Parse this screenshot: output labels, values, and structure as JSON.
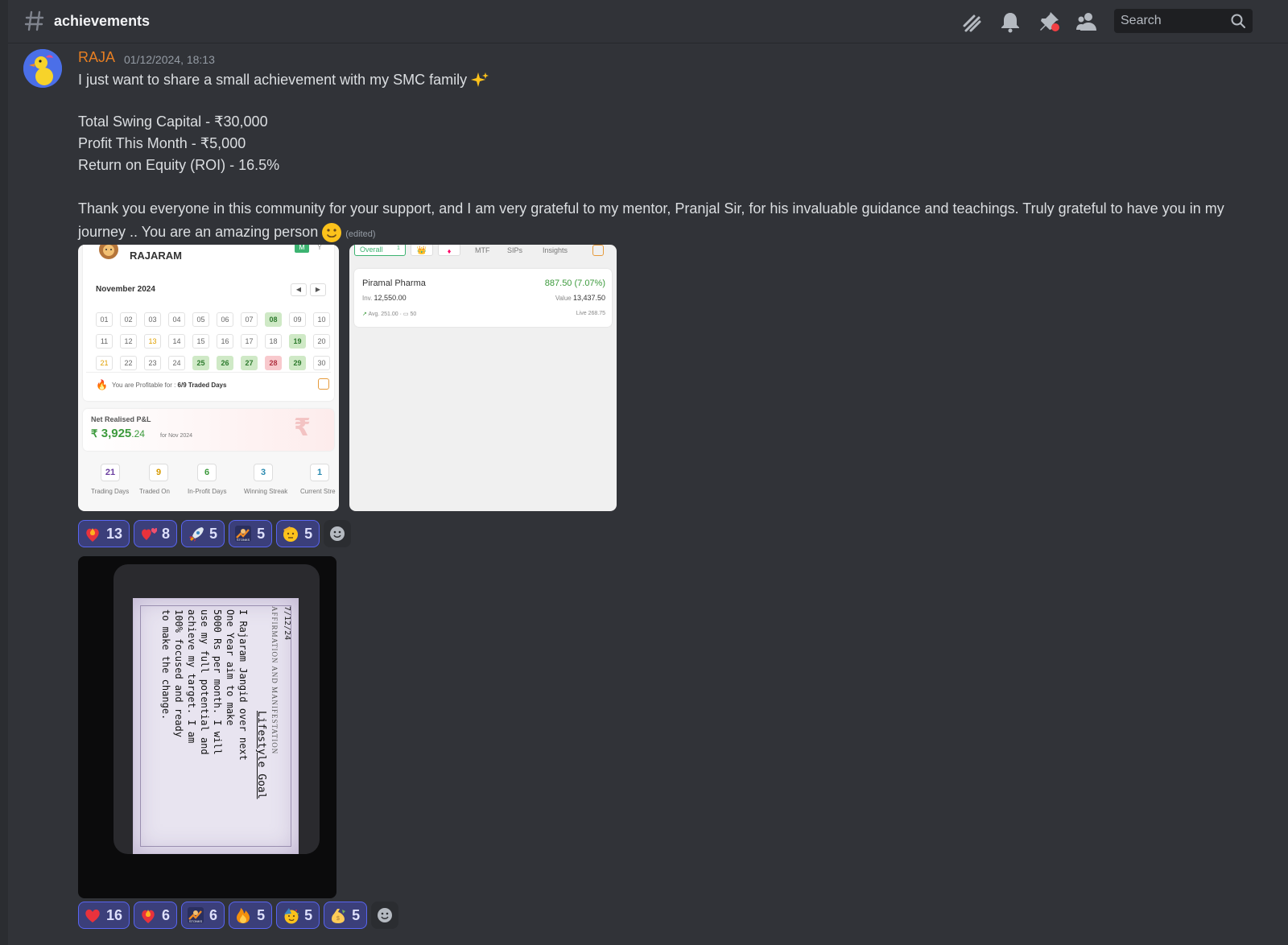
{
  "header": {
    "channel": "achievements",
    "search_placeholder": "Search",
    "icons": [
      "threads-icon",
      "bell-icon",
      "pin-icon",
      "members-icon",
      "search-icon"
    ]
  },
  "message": {
    "author": "RAJA",
    "author_color": "#e67e22",
    "timestamp": "01/12/2024, 18:13",
    "line1": "I just want to share a small achievement with my SMC family",
    "line2": "Total Swing Capital - ₹30,000",
    "line3": "Profit This Month - ₹5,000",
    "line4": "Return on Equity (ROI) - 16.5%",
    "line5": "Thank you everyone in this community for your support, and I am very grateful to my mentor, Pranjal Sir, for his invaluable guidance and teachings.  Truly grateful to have you in my",
    "line6": "journey .. You are an amazing person",
    "edited": "(edited)"
  },
  "shot1": {
    "name": "RAJARAM",
    "toggle_m": "M",
    "toggle_y": "Y",
    "month": "November 2024",
    "days": [
      [
        "01",
        "02",
        "03",
        "04",
        "05",
        "06",
        "07",
        "08",
        "09",
        "10"
      ],
      [
        "11",
        "12",
        "13",
        "14",
        "15",
        "16",
        "17",
        "18",
        "19",
        "20"
      ],
      [
        "21",
        "22",
        "23",
        "24",
        "25",
        "26",
        "27",
        "28",
        "29",
        "30"
      ]
    ],
    "profitable_label": "You are Profitable for : ",
    "profitable_value": "6/9 Traded Days",
    "pnl_label": "Net Realised P&L",
    "pnl_currency": "₹",
    "pnl_int": "3,925",
    "pnl_dec": ".24",
    "pnl_period": "for Nov 2024",
    "stats": [
      {
        "value": "21",
        "label": "Trading Days",
        "color": "#6b3fa0"
      },
      {
        "value": "9",
        "label": "Traded On",
        "color": "#d69a00"
      },
      {
        "value": "6",
        "label": "In-Profit Days",
        "color": "#3c9a3c"
      },
      {
        "value": "3",
        "label": "Winning Streak",
        "color": "#2a8ab0"
      },
      {
        "value": "1",
        "label": "Current Stre",
        "color": "#2a8ab0"
      }
    ]
  },
  "shot2": {
    "tabs": [
      "Overall",
      "1",
      "MTF",
      "SIPs",
      "Insights"
    ],
    "stock": "Piramal Pharma",
    "change": "887.50 (7.07%)",
    "inv_label": "Inv.",
    "inv_value": "12,550.00",
    "value_label": "Value",
    "value_value": "13,437.50",
    "avg": "Avg. 251.00",
    "qty": "50",
    "live": "Live  268.75"
  },
  "reactions1": [
    {
      "emoji": "heart-fire-icon",
      "count": "13"
    },
    {
      "emoji": "hearts-icon",
      "count": "8"
    },
    {
      "emoji": "rocket-icon",
      "count": "5"
    },
    {
      "emoji": "stonks-icon",
      "count": "5"
    },
    {
      "emoji": "saluting-face-icon",
      "count": "5"
    }
  ],
  "reactions2": [
    {
      "emoji": "red-heart-icon",
      "count": "16"
    },
    {
      "emoji": "heart-fire-icon",
      "count": "6"
    },
    {
      "emoji": "stonks-icon",
      "count": "6"
    },
    {
      "emoji": "fire-icon",
      "count": "5"
    },
    {
      "emoji": "partying-face-icon",
      "count": "5"
    },
    {
      "emoji": "money-bag-icon",
      "count": "5"
    }
  ],
  "photo": {
    "header": "7/12/24",
    "side_title": "AFFIRMATION AND MANIFESTATION",
    "goal_title": "Lifestyle Goal",
    "handwriting": [
      "I Rajaram Jangid over next",
      "One Year aim to make",
      "5000 Rs per month. I will",
      "use my full potential and",
      "achieve my target. I am",
      "100% focused and ready",
      "to make the change."
    ]
  },
  "colors": {
    "bg": "#313338",
    "reaction_bg": "#3b3f7a",
    "reaction_border": "#5865f2",
    "green": "#3c9a3c"
  }
}
